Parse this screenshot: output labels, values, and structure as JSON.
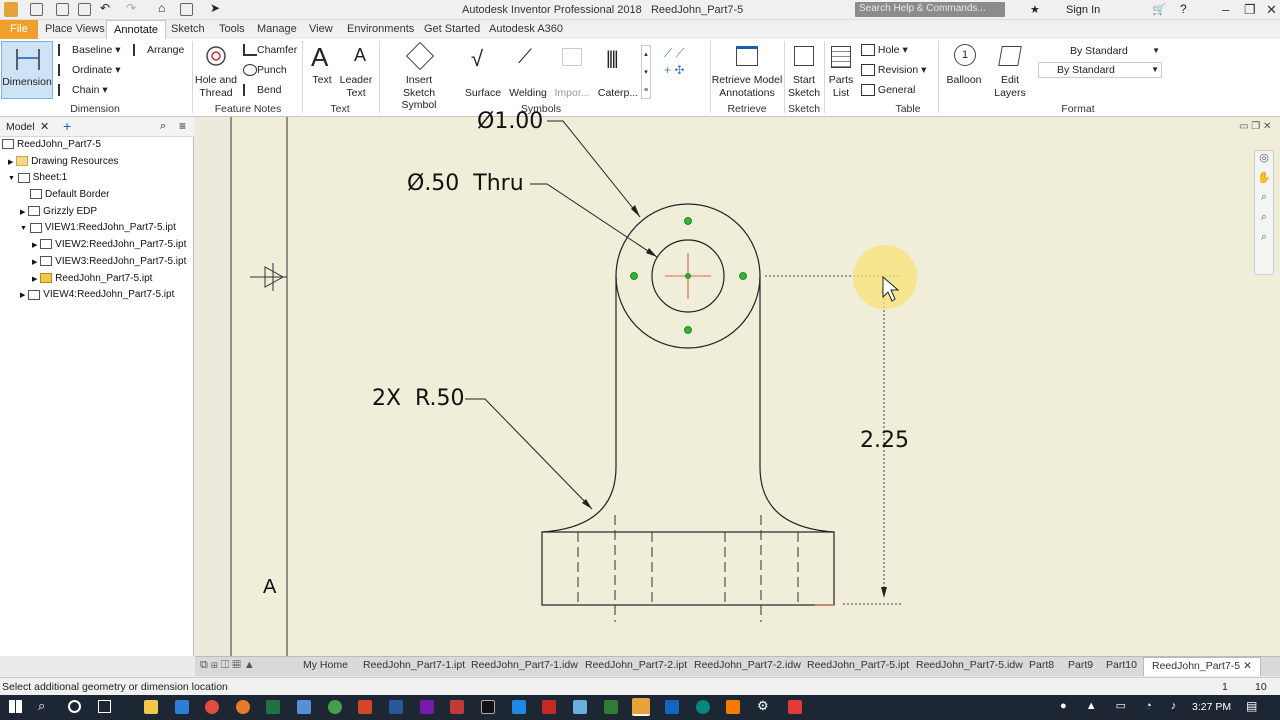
{
  "title_bar": {
    "app_title": "Autodesk Inventor Professional 2018",
    "document": "ReedJohn_Part7-5",
    "search_placeholder": "Search Help & Commands...",
    "sign_in": "Sign In"
  },
  "menu_tabs": [
    "File",
    "Place Views",
    "Annotate",
    "Sketch",
    "Tools",
    "Manage",
    "View",
    "Environments",
    "Get Started",
    "Autodesk A360"
  ],
  "active_tab": "Annotate",
  "ribbon": {
    "dimension": {
      "button": "Dimension",
      "baseline": "Baseline",
      "arrange": "Arrange",
      "ordinate": "Ordinate",
      "chain": "Chain",
      "panel": "Dimension"
    },
    "feature_notes": {
      "hole_and": "Hole and",
      "thread": "Thread",
      "chamfer": "Chamfer",
      "punch": "Punch",
      "bend": "Bend",
      "panel": "Feature Notes"
    },
    "text": {
      "text": "Text",
      "leader": "Leader",
      "leader_text": "Text",
      "panel": "Text"
    },
    "symbols": {
      "insert": "Insert",
      "sketch_symbol": "Sketch Symbol",
      "surface": "Surface",
      "welding": "Welding",
      "import": "Impor...",
      "caterpillar": "Caterp...",
      "panel": "Symbols"
    },
    "retrieve": {
      "line1": "Retrieve Model",
      "line2": "Annotations",
      "panel": "Retrieve"
    },
    "sketch": {
      "line1": "Start",
      "line2": "Sketch",
      "panel": "Sketch"
    },
    "table": {
      "parts": "Parts",
      "list": "List",
      "hole": "Hole",
      "revision": "Revision",
      "general": "General",
      "panel": "Table"
    },
    "balloon": "Balloon",
    "edit_layers": {
      "line1": "Edit",
      "line2": "Layers"
    },
    "format": {
      "style1": "By Standard",
      "style2": "By Standard",
      "panel": "Format"
    }
  },
  "browser": {
    "tab": "Model",
    "items": [
      {
        "label": "ReedJohn_Part7-5",
        "indent": 0
      },
      {
        "label": "Drawing Resources",
        "indent": 1
      },
      {
        "label": "Sheet:1",
        "indent": 1
      },
      {
        "label": "Default Border",
        "indent": 2
      },
      {
        "label": "Grizzly EDP",
        "indent": 2
      },
      {
        "label": "VIEW1:ReedJohn_Part7-5.ipt",
        "indent": 2
      },
      {
        "label": "VIEW2:ReedJohn_Part7-5.ipt",
        "indent": 3
      },
      {
        "label": "VIEW3:ReedJohn_Part7-5.ipt",
        "indent": 3
      },
      {
        "label": "ReedJohn_Part7-5.ipt",
        "indent": 3
      },
      {
        "label": "VIEW4:ReedJohn_Part7-5.ipt",
        "indent": 2
      }
    ]
  },
  "drawing": {
    "dim_outer_dia": "Ø1.00",
    "dim_hole": "Ø.50  Thru",
    "dim_radius": "2X  R.50",
    "dim_height": "2.25",
    "zone_letter": "A"
  },
  "doc_tabs": [
    "My Home",
    "ReedJohn_Part7-1.ipt",
    "ReedJohn_Part7-1.idw",
    "ReedJohn_Part7-2.ipt",
    "ReedJohn_Part7-2.idw",
    "ReedJohn_Part7-5.ipt",
    "ReedJohn_Part7-5.idw",
    "Part8",
    "Part9",
    "Part10",
    "ReedJohn_Part7-5"
  ],
  "status": {
    "message": "Select additional geometry or dimension location",
    "n1": "1",
    "n2": "10"
  },
  "taskbar": {
    "time": "3:27 PM"
  },
  "colors": {
    "file_tab": "#f0a02a",
    "sheet": "#f0edd9",
    "accent_select": "#cfe3f7",
    "snap_point": "#2db82d",
    "cursor_highlight": "#f5e27a"
  }
}
